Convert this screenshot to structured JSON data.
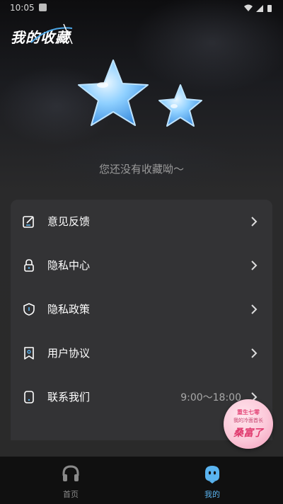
{
  "status_bar": {
    "time": "10:05"
  },
  "header": {
    "title": "我的收藏"
  },
  "empty_state": {
    "message": "您还没有收藏呦～"
  },
  "menu": {
    "items": [
      {
        "label": "意见反馈",
        "icon": "feedback-edit-icon"
      },
      {
        "label": "隐私中心",
        "icon": "lock-icon"
      },
      {
        "label": "隐私政策",
        "icon": "shield-icon"
      },
      {
        "label": "用户协议",
        "icon": "agreement-icon"
      },
      {
        "label": "联系我们",
        "icon": "phone-icon",
        "hours": "9:00～18:00"
      }
    ]
  },
  "promo": {
    "line1": "重生七零",
    "line2": "我的冷面首长",
    "line3": "桑富了"
  },
  "bottom_nav": {
    "tabs": [
      {
        "label": "首页",
        "icon": "headphones-icon",
        "active": false
      },
      {
        "label": "我的",
        "icon": "profile-face-icon",
        "active": true
      }
    ]
  },
  "colors": {
    "accent": "#5ab4f0",
    "card_bg": "#333335",
    "nav_bg": "#101010",
    "inactive_text": "#8a8a8a"
  }
}
